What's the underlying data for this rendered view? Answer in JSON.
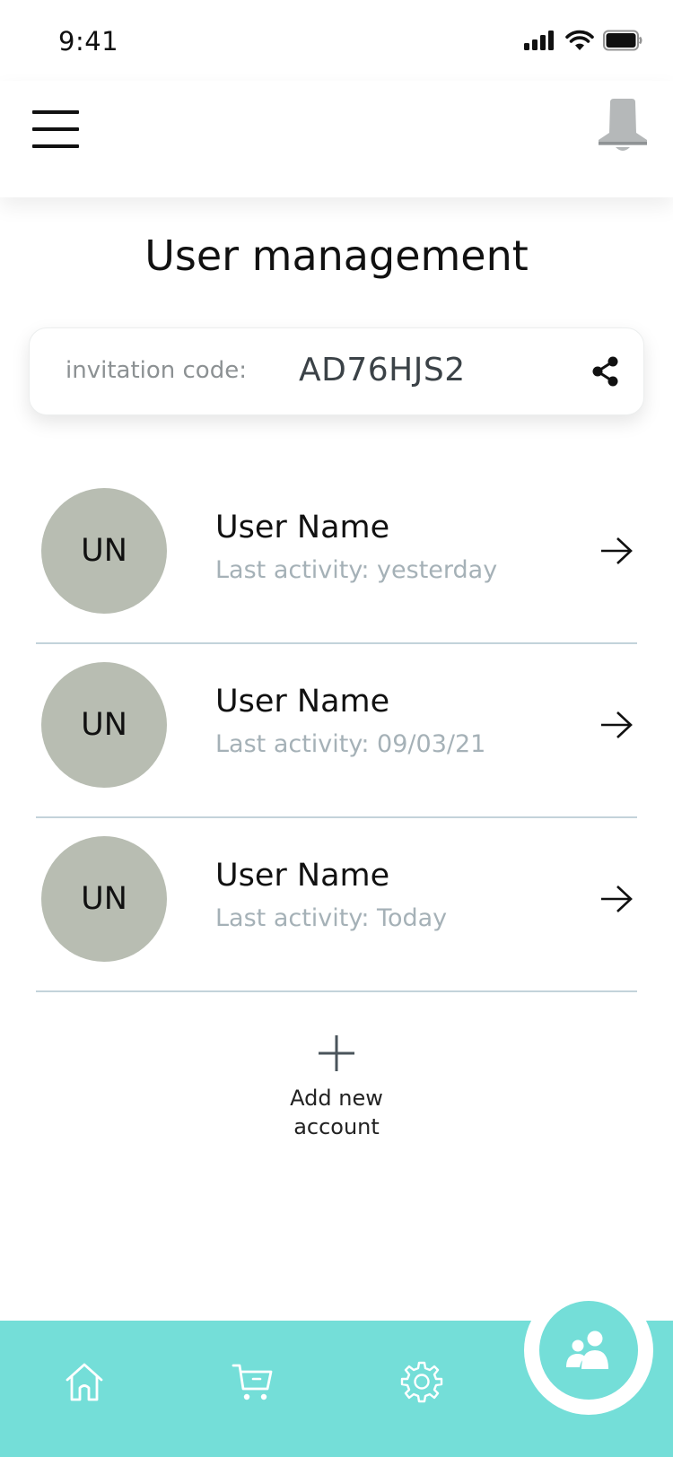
{
  "status_bar": {
    "time": "9:41",
    "icons": [
      "signal-icon",
      "wifi-icon",
      "battery-icon"
    ]
  },
  "header": {
    "menu_icon": "hamburger-menu-icon",
    "notification_icon": "bell-icon"
  },
  "page": {
    "title": "User management"
  },
  "invitation": {
    "label": "invitation code:",
    "code": "AD76HJS2",
    "share_icon": "share-icon"
  },
  "users": [
    {
      "initials": "UN",
      "name": "User Name",
      "activity": "Last activity: yesterday"
    },
    {
      "initials": "UN",
      "name": "User Name",
      "activity": "Last activity: 09/03/21"
    },
    {
      "initials": "UN",
      "name": "User Name",
      "activity": "Last activity: Today"
    }
  ],
  "add_account": {
    "label": "Add new account",
    "icon": "plus-icon"
  },
  "bottom_nav": {
    "items": [
      {
        "icon": "home-icon"
      },
      {
        "icon": "cart-icon"
      },
      {
        "icon": "settings-gear-icon"
      },
      {
        "icon": "users-icon",
        "active": true
      }
    ]
  },
  "colors": {
    "accent": "#74ded8",
    "avatar": "#b8bdb2",
    "activity_text": "#a5b1b7",
    "divider": "#c3d3da"
  }
}
